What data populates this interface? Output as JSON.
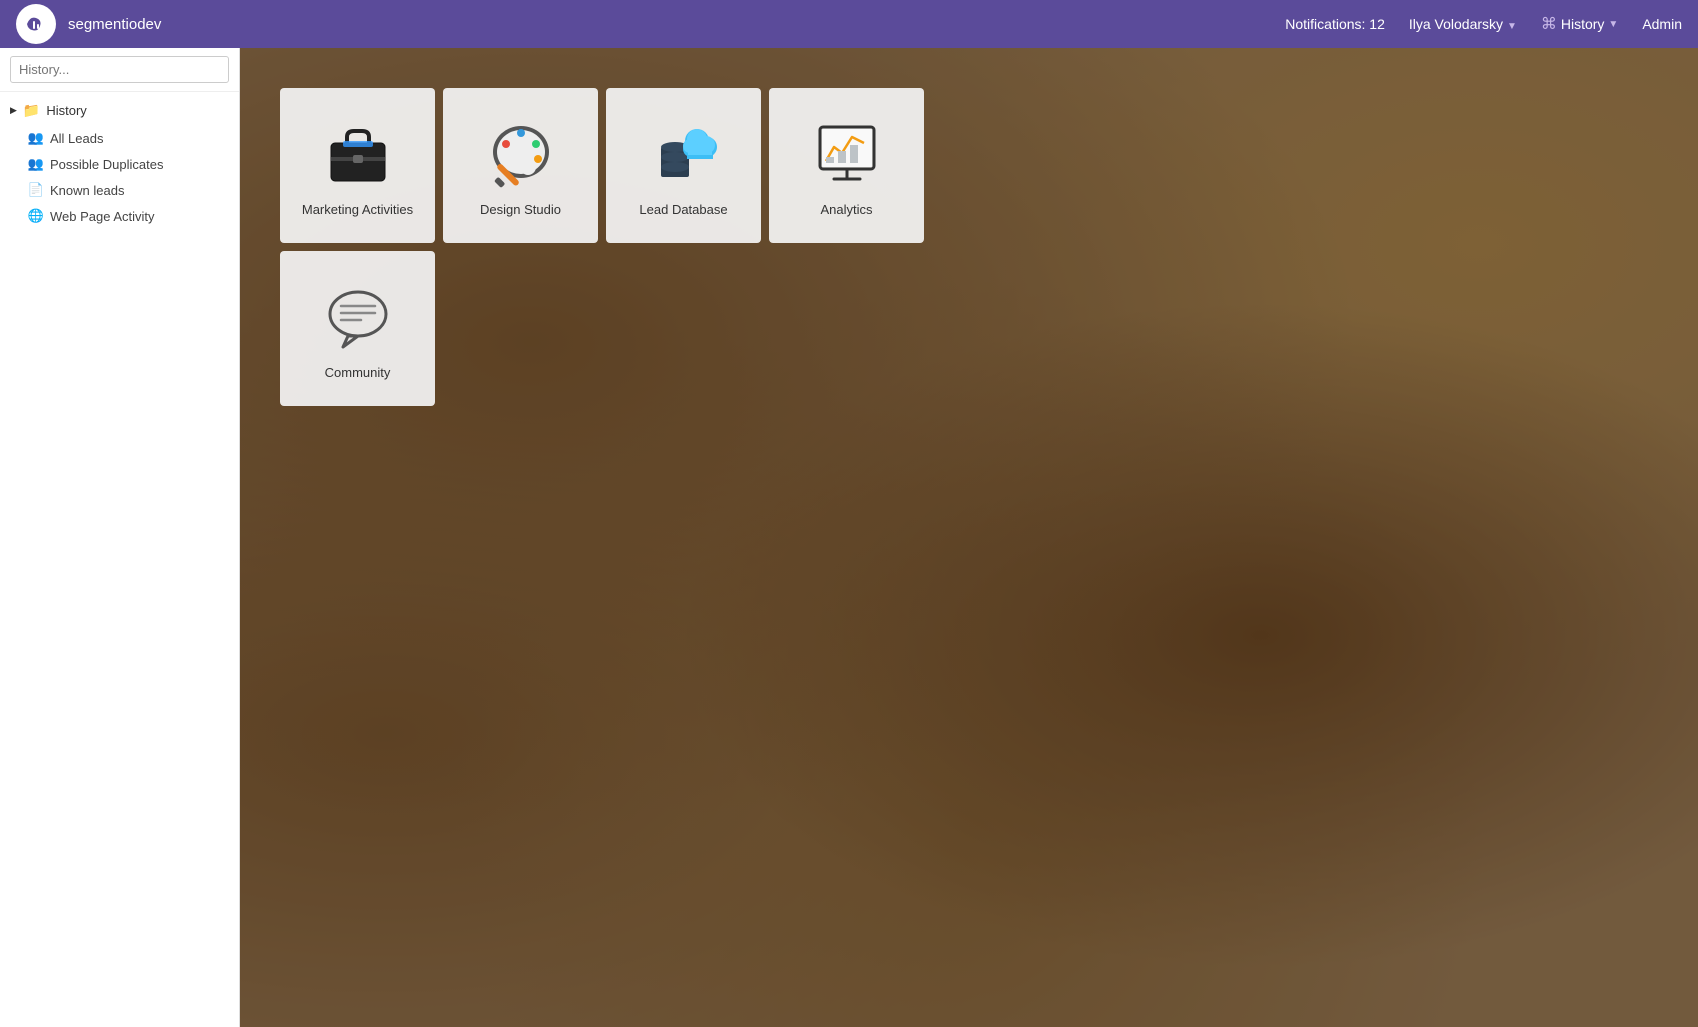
{
  "app": {
    "name": "segmentiodev"
  },
  "nav": {
    "notifications": "Notifications: 12",
    "user": "Ilya Volodarsky",
    "history": "History",
    "admin": "Admin"
  },
  "sidebar": {
    "search_placeholder": "History...",
    "section_label": "History",
    "items": [
      {
        "id": "all-leads",
        "label": "All Leads",
        "icon": "👥"
      },
      {
        "id": "possible-duplicates",
        "label": "Possible Duplicates",
        "icon": "👥"
      },
      {
        "id": "known-leads",
        "label": "Known leads",
        "icon": "📄"
      },
      {
        "id": "web-page-activity",
        "label": "Web Page Activity",
        "icon": "🌐"
      }
    ]
  },
  "tiles": [
    {
      "id": "marketing-activities",
      "label": "Marketing Activities",
      "icon": "💼",
      "color": "#333"
    },
    {
      "id": "design-studio",
      "label": "Design Studio",
      "icon": "🎨",
      "color": "#e67e22"
    },
    {
      "id": "lead-database",
      "label": "Lead Database",
      "icon": "🗄️",
      "color": "#3498db"
    },
    {
      "id": "analytics",
      "label": "Analytics",
      "icon": "📊",
      "color": "#333"
    },
    {
      "id": "community",
      "label": "Community",
      "icon": "💬",
      "color": "#333"
    }
  ]
}
